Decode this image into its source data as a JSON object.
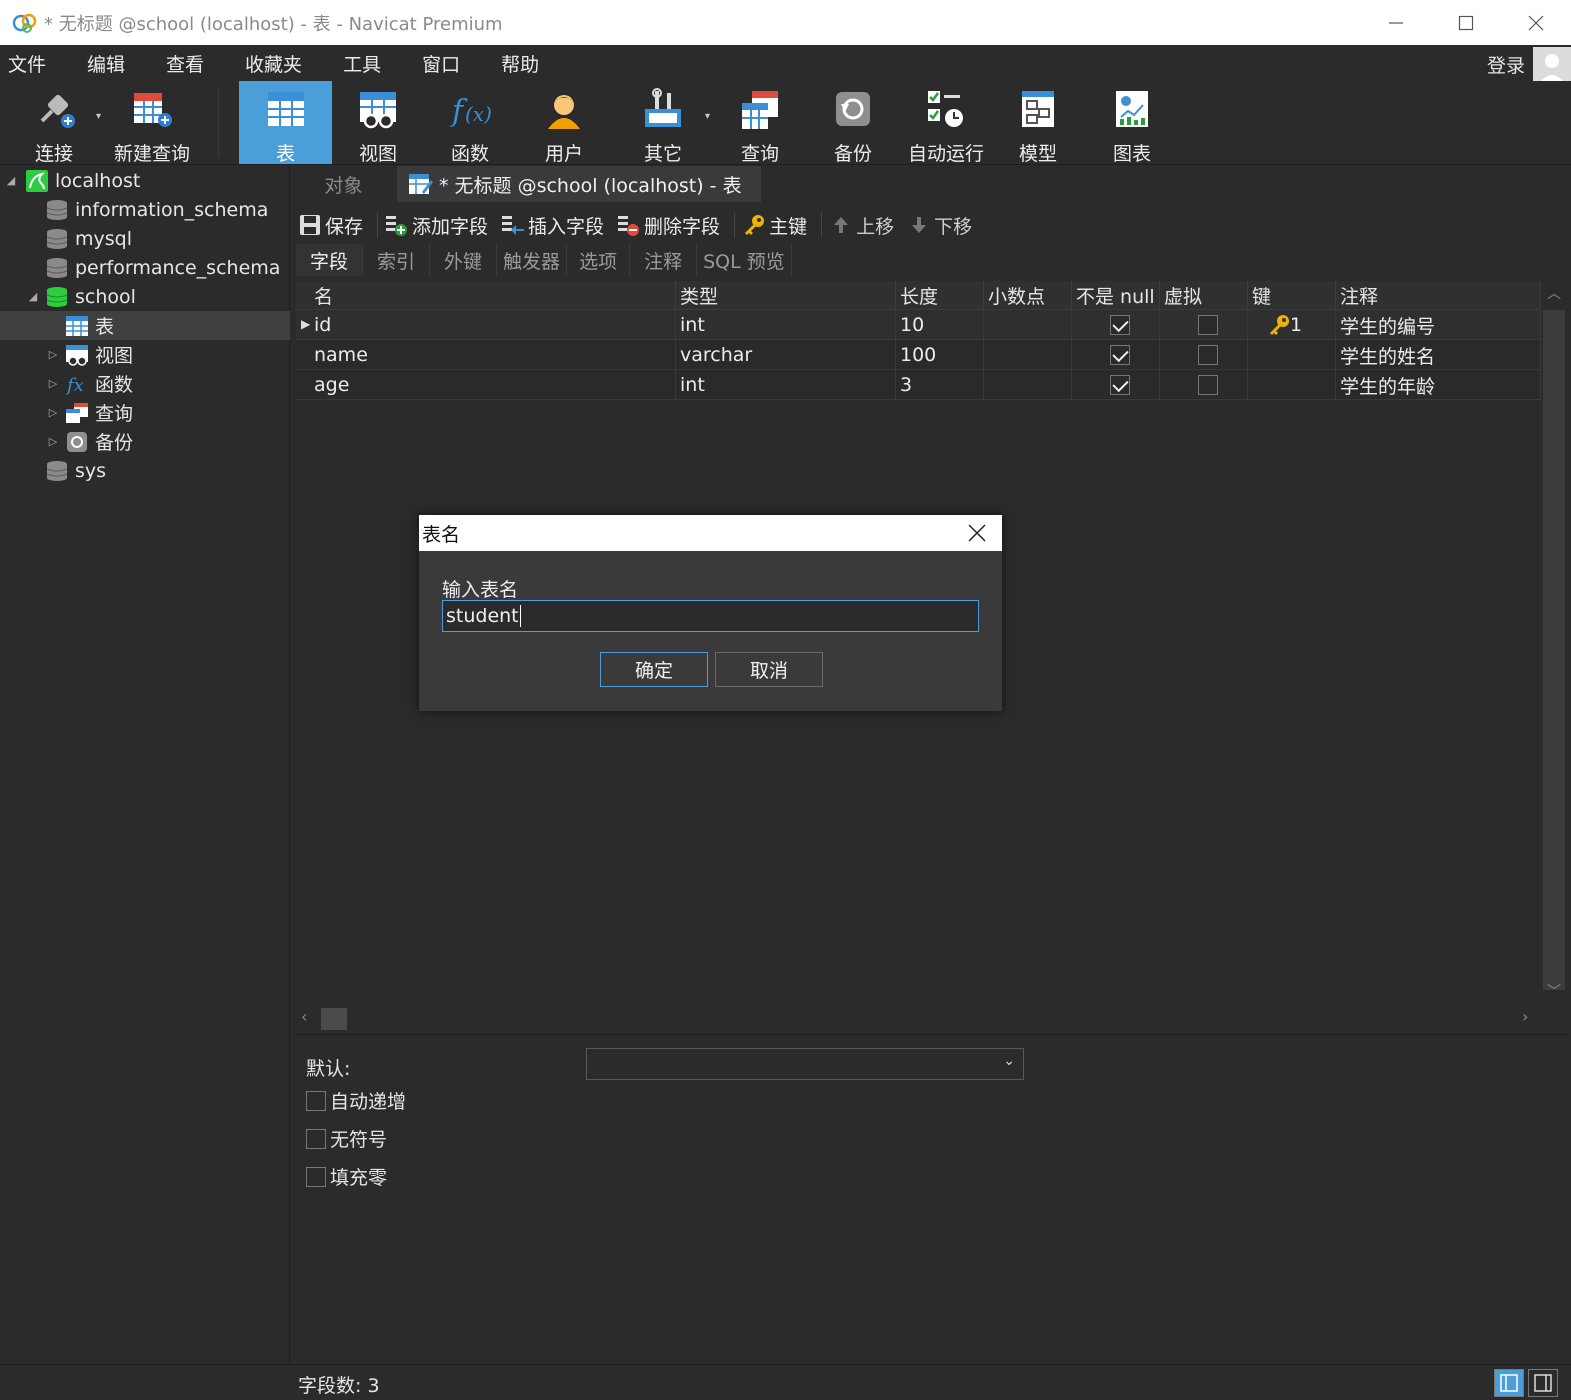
{
  "window": {
    "title": "* 无标题 @school (localhost) - 表 - Navicat Premium"
  },
  "menubar": {
    "items": [
      "文件",
      "编辑",
      "查看",
      "收藏夹",
      "工具",
      "窗口",
      "帮助"
    ],
    "login": "登录"
  },
  "toolbar": {
    "connect": "连接",
    "new_query": "新建查询",
    "table": "表",
    "view": "视图",
    "function": "函数",
    "user": "用户",
    "other": "其它",
    "query": "查询",
    "backup": "备份",
    "auto_run": "自动运行",
    "model": "模型",
    "chart": "图表"
  },
  "sidebar": {
    "connection": "localhost",
    "databases": [
      "information_schema",
      "mysql",
      "performance_schema",
      "school",
      "sys"
    ],
    "school_children": [
      "表",
      "视图",
      "函数",
      "查询",
      "备份"
    ]
  },
  "tabs": {
    "objects": "对象",
    "editor": "* 无标题 @school (localhost) - 表"
  },
  "subtoolbar": {
    "save": "保存",
    "add_field": "添加字段",
    "insert_field": "插入字段",
    "delete_field": "删除字段",
    "primary_key": "主键",
    "move_up": "上移",
    "move_down": "下移"
  },
  "subtabs": [
    "字段",
    "索引",
    "外键",
    "触发器",
    "选项",
    "注释",
    "SQL 预览"
  ],
  "grid": {
    "headers": [
      "名",
      "类型",
      "长度",
      "小数点",
      "不是 null",
      "虚拟",
      "键",
      "注释"
    ],
    "rows": [
      {
        "name": "id",
        "type": "int",
        "length": "10",
        "decimals": "",
        "not_null": true,
        "virtual": false,
        "key": "1",
        "comment": "学生的编号"
      },
      {
        "name": "name",
        "type": "varchar",
        "length": "100",
        "decimals": "",
        "not_null": true,
        "virtual": false,
        "key": "",
        "comment": "学生的姓名"
      },
      {
        "name": "age",
        "type": "int",
        "length": "3",
        "decimals": "",
        "not_null": true,
        "virtual": false,
        "key": "",
        "comment": "学生的年龄"
      }
    ]
  },
  "props": {
    "default_label": "默认:",
    "auto_increment": "自动递增",
    "unsigned": "无符号",
    "zerofill": "填充零"
  },
  "status": {
    "field_count": "字段数: 3"
  },
  "dialog": {
    "title": "表名",
    "prompt": "输入表名",
    "value": "student",
    "ok": "确定",
    "cancel": "取消"
  },
  "colors": {
    "accent": "#4a9fd8",
    "background": "#2b2b2b",
    "school_db": "#2ecc40",
    "key": "#f0b400"
  }
}
